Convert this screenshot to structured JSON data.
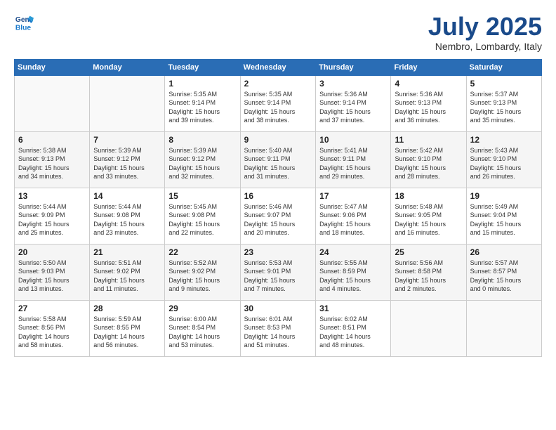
{
  "header": {
    "logo_line1": "General",
    "logo_line2": "Blue",
    "month": "July 2025",
    "location": "Nembro, Lombardy, Italy"
  },
  "weekdays": [
    "Sunday",
    "Monday",
    "Tuesday",
    "Wednesday",
    "Thursday",
    "Friday",
    "Saturday"
  ],
  "weeks": [
    [
      {
        "day": "",
        "info": ""
      },
      {
        "day": "",
        "info": ""
      },
      {
        "day": "1",
        "info": "Sunrise: 5:35 AM\nSunset: 9:14 PM\nDaylight: 15 hours\nand 39 minutes."
      },
      {
        "day": "2",
        "info": "Sunrise: 5:35 AM\nSunset: 9:14 PM\nDaylight: 15 hours\nand 38 minutes."
      },
      {
        "day": "3",
        "info": "Sunrise: 5:36 AM\nSunset: 9:14 PM\nDaylight: 15 hours\nand 37 minutes."
      },
      {
        "day": "4",
        "info": "Sunrise: 5:36 AM\nSunset: 9:13 PM\nDaylight: 15 hours\nand 36 minutes."
      },
      {
        "day": "5",
        "info": "Sunrise: 5:37 AM\nSunset: 9:13 PM\nDaylight: 15 hours\nand 35 minutes."
      }
    ],
    [
      {
        "day": "6",
        "info": "Sunrise: 5:38 AM\nSunset: 9:13 PM\nDaylight: 15 hours\nand 34 minutes."
      },
      {
        "day": "7",
        "info": "Sunrise: 5:39 AM\nSunset: 9:12 PM\nDaylight: 15 hours\nand 33 minutes."
      },
      {
        "day": "8",
        "info": "Sunrise: 5:39 AM\nSunset: 9:12 PM\nDaylight: 15 hours\nand 32 minutes."
      },
      {
        "day": "9",
        "info": "Sunrise: 5:40 AM\nSunset: 9:11 PM\nDaylight: 15 hours\nand 31 minutes."
      },
      {
        "day": "10",
        "info": "Sunrise: 5:41 AM\nSunset: 9:11 PM\nDaylight: 15 hours\nand 29 minutes."
      },
      {
        "day": "11",
        "info": "Sunrise: 5:42 AM\nSunset: 9:10 PM\nDaylight: 15 hours\nand 28 minutes."
      },
      {
        "day": "12",
        "info": "Sunrise: 5:43 AM\nSunset: 9:10 PM\nDaylight: 15 hours\nand 26 minutes."
      }
    ],
    [
      {
        "day": "13",
        "info": "Sunrise: 5:44 AM\nSunset: 9:09 PM\nDaylight: 15 hours\nand 25 minutes."
      },
      {
        "day": "14",
        "info": "Sunrise: 5:44 AM\nSunset: 9:08 PM\nDaylight: 15 hours\nand 23 minutes."
      },
      {
        "day": "15",
        "info": "Sunrise: 5:45 AM\nSunset: 9:08 PM\nDaylight: 15 hours\nand 22 minutes."
      },
      {
        "day": "16",
        "info": "Sunrise: 5:46 AM\nSunset: 9:07 PM\nDaylight: 15 hours\nand 20 minutes."
      },
      {
        "day": "17",
        "info": "Sunrise: 5:47 AM\nSunset: 9:06 PM\nDaylight: 15 hours\nand 18 minutes."
      },
      {
        "day": "18",
        "info": "Sunrise: 5:48 AM\nSunset: 9:05 PM\nDaylight: 15 hours\nand 16 minutes."
      },
      {
        "day": "19",
        "info": "Sunrise: 5:49 AM\nSunset: 9:04 PM\nDaylight: 15 hours\nand 15 minutes."
      }
    ],
    [
      {
        "day": "20",
        "info": "Sunrise: 5:50 AM\nSunset: 9:03 PM\nDaylight: 15 hours\nand 13 minutes."
      },
      {
        "day": "21",
        "info": "Sunrise: 5:51 AM\nSunset: 9:02 PM\nDaylight: 15 hours\nand 11 minutes."
      },
      {
        "day": "22",
        "info": "Sunrise: 5:52 AM\nSunset: 9:02 PM\nDaylight: 15 hours\nand 9 minutes."
      },
      {
        "day": "23",
        "info": "Sunrise: 5:53 AM\nSunset: 9:01 PM\nDaylight: 15 hours\nand 7 minutes."
      },
      {
        "day": "24",
        "info": "Sunrise: 5:55 AM\nSunset: 8:59 PM\nDaylight: 15 hours\nand 4 minutes."
      },
      {
        "day": "25",
        "info": "Sunrise: 5:56 AM\nSunset: 8:58 PM\nDaylight: 15 hours\nand 2 minutes."
      },
      {
        "day": "26",
        "info": "Sunrise: 5:57 AM\nSunset: 8:57 PM\nDaylight: 15 hours\nand 0 minutes."
      }
    ],
    [
      {
        "day": "27",
        "info": "Sunrise: 5:58 AM\nSunset: 8:56 PM\nDaylight: 14 hours\nand 58 minutes."
      },
      {
        "day": "28",
        "info": "Sunrise: 5:59 AM\nSunset: 8:55 PM\nDaylight: 14 hours\nand 56 minutes."
      },
      {
        "day": "29",
        "info": "Sunrise: 6:00 AM\nSunset: 8:54 PM\nDaylight: 14 hours\nand 53 minutes."
      },
      {
        "day": "30",
        "info": "Sunrise: 6:01 AM\nSunset: 8:53 PM\nDaylight: 14 hours\nand 51 minutes."
      },
      {
        "day": "31",
        "info": "Sunrise: 6:02 AM\nSunset: 8:51 PM\nDaylight: 14 hours\nand 48 minutes."
      },
      {
        "day": "",
        "info": ""
      },
      {
        "day": "",
        "info": ""
      }
    ]
  ]
}
